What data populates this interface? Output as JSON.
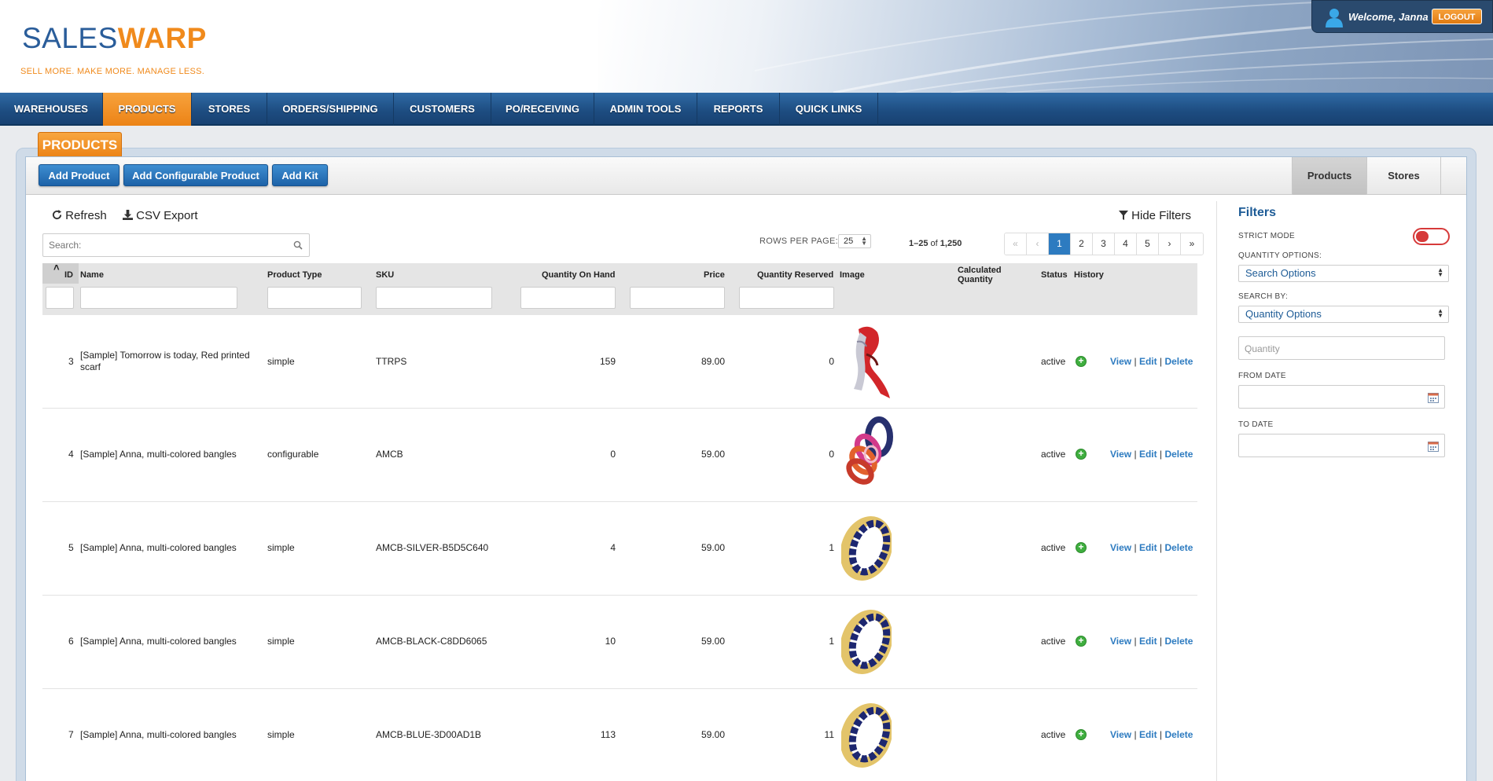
{
  "brand": {
    "logo_sales": "SALES",
    "logo_warp": "WARP",
    "tagline": "SELL MORE. MAKE MORE. MANAGE LESS."
  },
  "user": {
    "welcome": "Welcome, Janna",
    "logout": "LOGOUT"
  },
  "nav": {
    "items": [
      {
        "label": "WAREHOUSES"
      },
      {
        "label": "PRODUCTS"
      },
      {
        "label": "STORES"
      },
      {
        "label": "ORDERS/SHIPPING"
      },
      {
        "label": "CUSTOMERS"
      },
      {
        "label": "PO/RECEIVING"
      },
      {
        "label": "ADMIN TOOLS"
      },
      {
        "label": "REPORTS"
      },
      {
        "label": "QUICK LINKS"
      }
    ],
    "active": "PRODUCTS"
  },
  "page": {
    "section_title": "PRODUCTS",
    "buttons": {
      "add_product": "Add Product",
      "add_configurable": "Add Configurable Product",
      "add_kit": "Add Kit"
    },
    "right_tabs": [
      "Products",
      "Stores"
    ],
    "actions": {
      "refresh": "Refresh",
      "csv_export": "CSV Export",
      "hide_filters": "Hide Filters"
    },
    "search_placeholder": "Search:",
    "rows_per_page_label": "ROWS PER PAGE:",
    "rows_per_page_value": "25",
    "range_prefix": "1–25",
    "range_of": " of ",
    "range_total": "1,250",
    "pager": [
      "«",
      "‹",
      "1",
      "2",
      "3",
      "4",
      "5",
      "›",
      "»"
    ],
    "current_page": "1"
  },
  "table": {
    "columns": {
      "id": "ID",
      "name": "Name",
      "product_type": "Product Type",
      "sku": "SKU",
      "qty_on_hand": "Quantity On Hand",
      "price": "Price",
      "qty_reserved": "Quantity Reserved",
      "image": "Image",
      "calc_qty_1": "Calculated",
      "calc_qty_2": "Quantity",
      "status": "Status",
      "history": "History"
    },
    "sort_indicator": "˄",
    "rows": [
      {
        "id": "3",
        "name": "[Sample] Tomorrow is today, Red printed scarf",
        "type": "simple",
        "sku": "TTRPS",
        "qoh": "159",
        "price": "89.00",
        "reserved": "0",
        "image": "scarf",
        "status": "active"
      },
      {
        "id": "4",
        "name": "[Sample] Anna, multi-colored bangles",
        "type": "configurable",
        "sku": "AMCB",
        "qoh": "0",
        "price": "59.00",
        "reserved": "0",
        "image": "bangles-multi",
        "status": "active"
      },
      {
        "id": "5",
        "name": "[Sample] Anna, multi-colored bangles",
        "type": "simple",
        "sku": "AMCB-SILVER-B5D5C640",
        "qoh": "4",
        "price": "59.00",
        "reserved": "1",
        "image": "bangle-gold",
        "status": "active"
      },
      {
        "id": "6",
        "name": "[Sample] Anna, multi-colored bangles",
        "type": "simple",
        "sku": "AMCB-BLACK-C8DD6065",
        "qoh": "10",
        "price": "59.00",
        "reserved": "1",
        "image": "bangle-gold",
        "status": "active"
      },
      {
        "id": "7",
        "name": "[Sample] Anna, multi-colored bangles",
        "type": "simple",
        "sku": "AMCB-BLUE-3D00AD1B",
        "qoh": "113",
        "price": "59.00",
        "reserved": "11",
        "image": "bangle-gold",
        "status": "active"
      }
    ],
    "row_actions": {
      "view": "View",
      "edit": "Edit",
      "delete": "Delete",
      "sep": "|"
    }
  },
  "filters": {
    "title": "Filters",
    "strict_mode": "STRICT MODE",
    "quantity_options_label": "QUANTITY OPTIONS:",
    "quantity_options_value": "Search Options",
    "search_by_label": "SEARCH BY:",
    "search_by_value": "Quantity Options",
    "quantity_placeholder": "Quantity",
    "from_date": "FROM DATE",
    "to_date": "TO DATE"
  },
  "colors": {
    "brand_blue": "#2a5d9a",
    "brand_orange": "#f08a1c",
    "link": "#2d7bc0",
    "active_green": "#3fae3f",
    "toggle_red": "#d63a3a"
  }
}
